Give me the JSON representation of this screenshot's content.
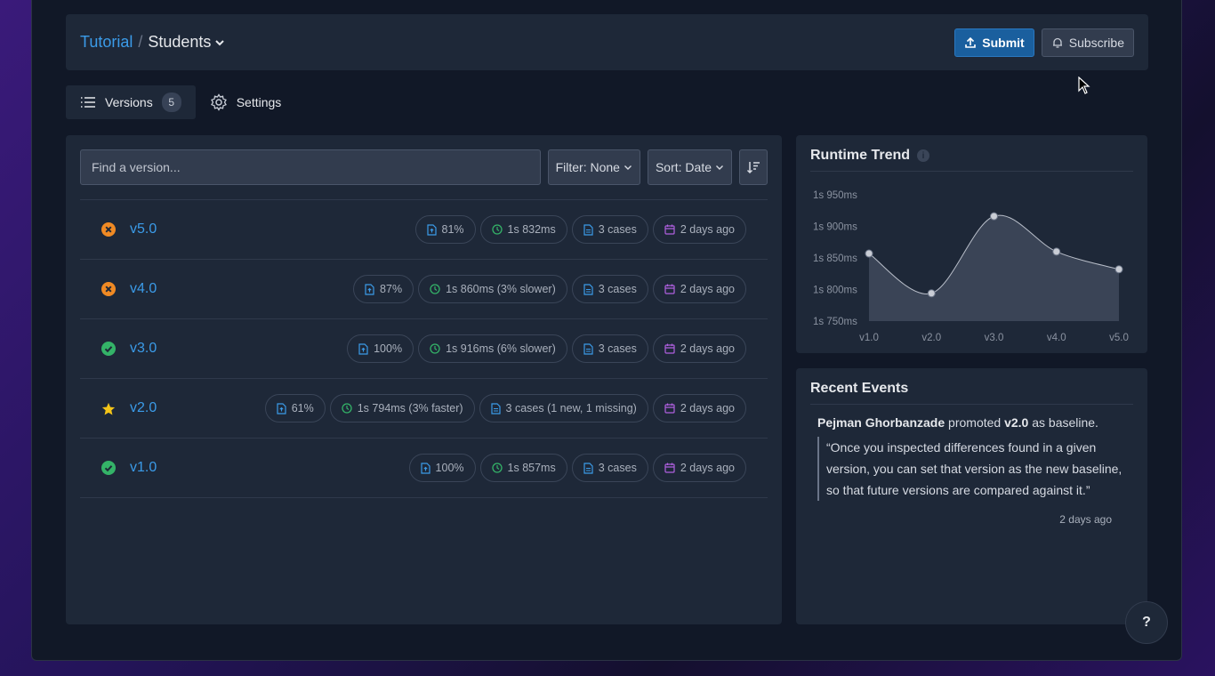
{
  "breadcrumb": {
    "parent": "Tutorial",
    "separator": "/",
    "current": "Students"
  },
  "header": {
    "submit_label": "Submit",
    "subscribe_label": "Subscribe"
  },
  "tabs": [
    {
      "label": "Versions",
      "count": "5"
    },
    {
      "label": "Settings"
    }
  ],
  "toolbar": {
    "search_placeholder": "Find a version...",
    "filter_label": "Filter: None",
    "sort_label": "Sort: Date"
  },
  "versions": [
    {
      "name": "v5.0",
      "status": "failed",
      "coverage": "81%",
      "runtime": "1s 832ms",
      "cases": "3 cases",
      "date": "2 days ago"
    },
    {
      "name": "v4.0",
      "status": "failed",
      "coverage": "87%",
      "runtime": "1s 860ms (3% slower)",
      "cases": "3 cases",
      "date": "2 days ago"
    },
    {
      "name": "v3.0",
      "status": "passed",
      "coverage": "100%",
      "runtime": "1s 916ms (6% slower)",
      "cases": "3 cases",
      "date": "2 days ago"
    },
    {
      "name": "v2.0",
      "status": "baseline",
      "coverage": "61%",
      "runtime": "1s 794ms (3% faster)",
      "cases": "3 cases (1 new, 1 missing)",
      "date": "2 days ago"
    },
    {
      "name": "v1.0",
      "status": "passed",
      "coverage": "100%",
      "runtime": "1s 857ms",
      "cases": "3 cases",
      "date": "2 days ago"
    }
  ],
  "trend": {
    "title": "Runtime Trend",
    "y_ticks": [
      "1s 950ms",
      "1s 900ms",
      "1s 850ms",
      "1s 800ms",
      "1s 750ms"
    ]
  },
  "chart_data": {
    "type": "area",
    "title": "Runtime Trend",
    "categories": [
      "v1.0",
      "v2.0",
      "v3.0",
      "v4.0",
      "v5.0"
    ],
    "values": [
      1857,
      1794,
      1916,
      1860,
      1832
    ],
    "unit": "ms",
    "ylim": [
      1750,
      1950
    ],
    "grid": false
  },
  "events": {
    "title": "Recent Events",
    "actor": "Pejman Ghorbanzade",
    "action": "promoted",
    "target": "v2.0",
    "suffix": "as baseline.",
    "quote": "“Once you inspected differences found in a given version, you can set that version as the new baseline, so that future versions are compared against it.”",
    "time": "2 days ago"
  },
  "help_label": "?",
  "colors": {
    "accent": "#3b9be8",
    "failed": "#f08a24",
    "passed": "#34b368",
    "baseline": "#f5c518",
    "coverage_icon": "#3b9be8",
    "runtime_icon": "#34b368",
    "cases_icon": "#3b9be8",
    "date_icon": "#b060e0"
  }
}
